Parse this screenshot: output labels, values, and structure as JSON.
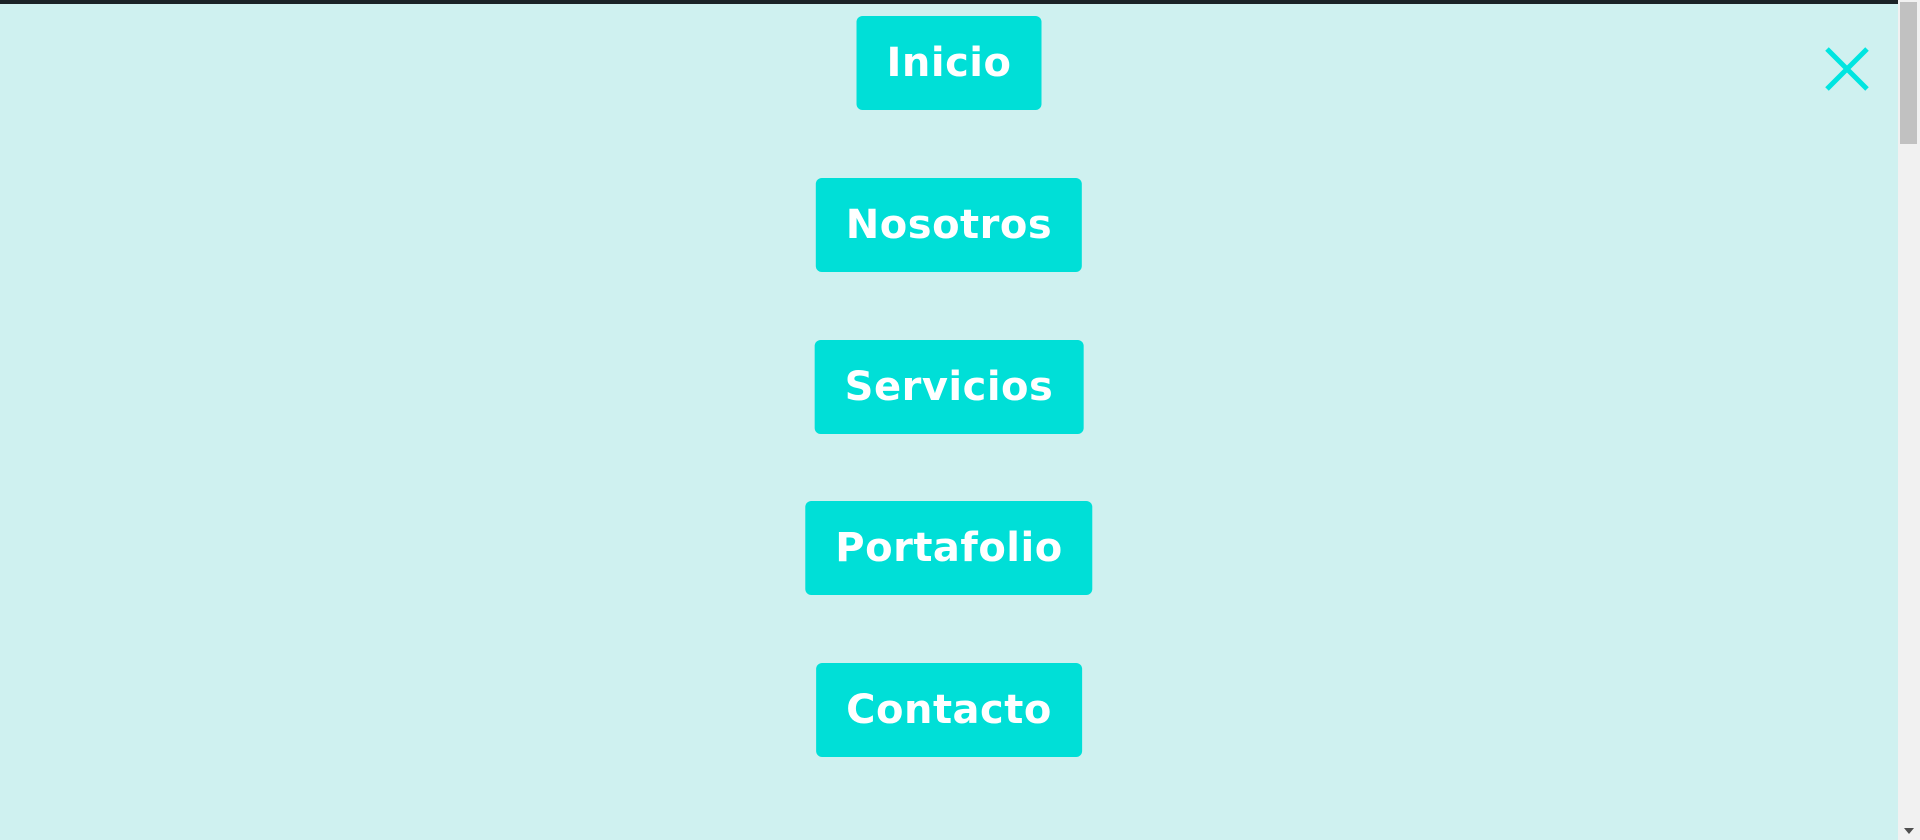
{
  "menu": {
    "items": [
      {
        "label": "Inicio"
      },
      {
        "label": "Nosotros"
      },
      {
        "label": "Servicios"
      },
      {
        "label": "Portafolio"
      },
      {
        "label": "Contacto"
      }
    ],
    "close_icon": "close-icon"
  },
  "colors": {
    "background": "#cff1f0",
    "button": "#00dfd7",
    "button_text": "#ffffff",
    "close_icon": "#00e5e0"
  }
}
